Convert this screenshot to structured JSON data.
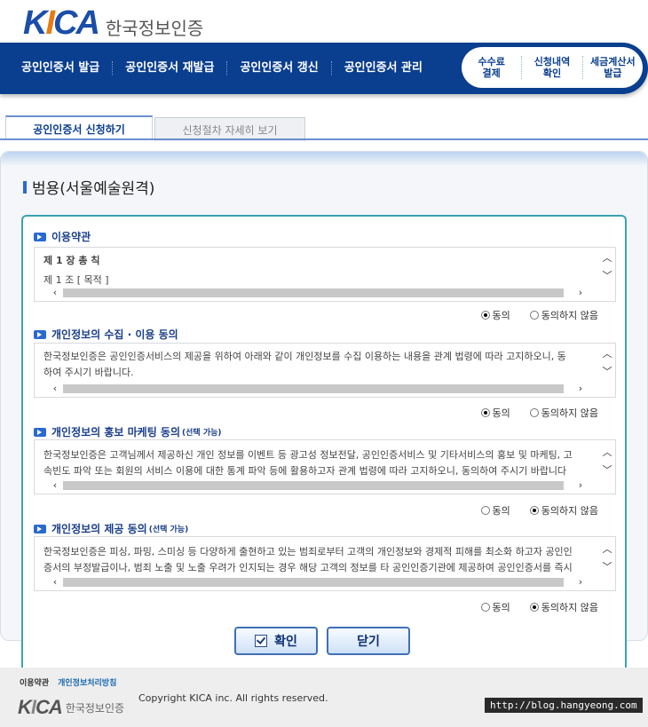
{
  "brand": {
    "mark_a": "K",
    "mark_b": "I",
    "mark_c": "CA",
    "name": "한국정보인증"
  },
  "nav": {
    "items": [
      "공인인증서 발급",
      "공인인증서 재발급",
      "공인인증서 갱신",
      "공인인증서 관리"
    ],
    "sub": [
      {
        "line1": "수수료",
        "line2": "결제"
      },
      {
        "line1": "신청내역",
        "line2": "확인"
      },
      {
        "line1": "세금계산서",
        "line2": "발급"
      }
    ]
  },
  "tabs": {
    "active": "공인인증서 신청하기",
    "inactive": "신청절차 자세히 보기"
  },
  "page_title": "범용(서울예술원격)",
  "sections": [
    {
      "title": "이용약관",
      "title_note": "",
      "lines": [
        "제 1 장 총 칙",
        "",
        "제 1 조 [ 목적 ]"
      ],
      "agree": "동의",
      "disagree": "동의하지 않음",
      "selected": "agree"
    },
    {
      "title": "개인정보의 수집 · 이용 동의",
      "title_note": "",
      "lines": [
        "한국정보인증은 공인인증서비스의 제공을 위하여 아래와 같이 개인정보를 수집 이용하는 내용을 관계 법령에 따라 고지하오니, 동",
        "하여 주시기 바랍니다."
      ],
      "agree": "동의",
      "disagree": "동의하지 않음",
      "selected": "agree"
    },
    {
      "title": "개인정보의 홍보 마케팅 동의",
      "title_note": "(선택 가능)",
      "lines": [
        "한국정보인증은 고객님께서 제공하신 개인 정보를 이벤트 등 광고성 정보전달, 공인인증서비스 및 기타서비스의 홍보 및 마케팅, 고",
        "속빈도 파악 또는 회원의 서비스 이용에 대한 통계 파악 등에 활용하고자 관계 법령에 따라 고지하오니, 동의하여 주시기 바랍니다"
      ],
      "agree": "동의",
      "disagree": "동의하지 않음",
      "selected": "disagree"
    },
    {
      "title": "개인정보의 제공 동의",
      "title_note": "(선택 가능)",
      "lines": [
        "한국정보인증은 피싱, 파밍, 스미싱 등 다양하게 출현하고 있는 범죄로부터 고객의 개인정보와 경제적 피해를 최소화 하고자 공인인",
        "증서의 부정발급이나, 범죄 노출 및 노출 우려가 인지되는 경우 해당 고객의 정보를 타 공인인증기관에 제공하여 공인인증서를 즉시"
      ],
      "agree": "동의",
      "disagree": "동의하지 않음",
      "selected": "disagree"
    }
  ],
  "buttons": {
    "confirm": "확인",
    "close": "닫기"
  },
  "footer": {
    "link1": "이용약관",
    "link2": "개인정보처리방침",
    "copyright": "Copyright KICA inc. All rights reserved.",
    "logo_mark_a": "K",
    "logo_mark_b": "I",
    "logo_mark_c": "CA",
    "logo_text": "한국정보인증",
    "watermark": "http://blog.hangyeong.com"
  },
  "colors": {
    "nav": "#0a3e8f",
    "accent_orange": "#e87a10",
    "box_border": "#3aa3b2"
  }
}
